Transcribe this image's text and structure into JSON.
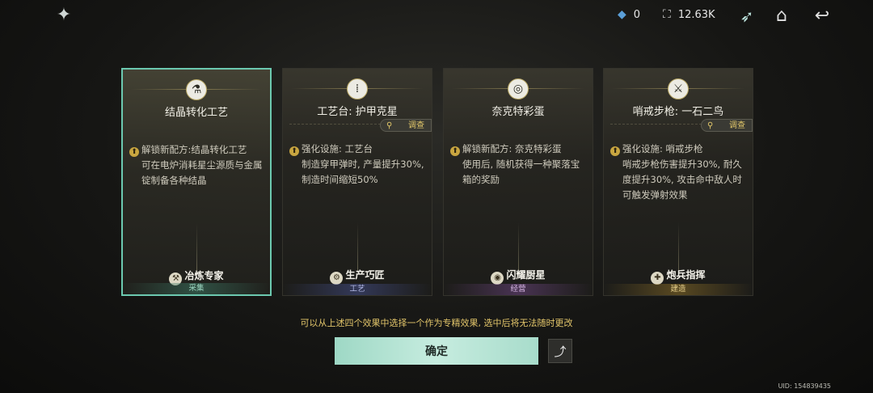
{
  "topbar": {
    "logo_icon": "star-emblem-icon",
    "resources": [
      {
        "icon": "gem-icon",
        "value": "0"
      },
      {
        "icon": "capacity-icon",
        "value": "12.63K"
      }
    ],
    "icons": [
      "faction-emblem-icon",
      "home-icon",
      "back-icon"
    ]
  },
  "cards": [
    {
      "title": "结晶转化工艺",
      "show_inspect": false,
      "inspect_label": "",
      "desc_lead": "解锁新配方:结晶转化工艺",
      "desc_rest": "可在电炉消耗星尘源质与金属锭制备各种结晶",
      "profession": "冶炼专家",
      "category": "采集",
      "selected": true
    },
    {
      "title": "工艺台: 护甲克星",
      "show_inspect": true,
      "inspect_label": "调查",
      "desc_lead": "强化设施: 工艺台",
      "desc_rest": "制造穿甲弹时, 产量提升30%, 制造时间缩短50%",
      "profession": "生产巧匠",
      "category": "工艺",
      "selected": false
    },
    {
      "title": "奈克特彩蛋",
      "show_inspect": false,
      "inspect_label": "",
      "desc_lead": "解锁新配方: 奈克特彩蛋",
      "desc_rest": "使用后, 随机获得一种聚落宝箱的奖励",
      "profession": "闪耀厨星",
      "category": "经营",
      "selected": false
    },
    {
      "title": "哨戒步枪: 一石二鸟",
      "show_inspect": true,
      "inspect_label": "调查",
      "desc_lead": "强化设施: 哨戒步枪",
      "desc_rest": "哨戒步枪伤害提升30%, 耐久度提升30%, 攻击命中敌人时可触发弹射效果",
      "profession": "炮兵指挥",
      "category": "建造",
      "selected": false
    }
  ],
  "hint": "可以从上述四个效果中选择一个作为专精效果, 选中后将无法随时更改",
  "confirm_label": "确定",
  "share_icon": "share-icon",
  "uid": "UID: 154839435",
  "colors": {
    "selected_border": "#6cc9b0",
    "confirm_bg": "#b6e4d4",
    "hint": "#e2c56a",
    "bullet": "#c9a640"
  }
}
